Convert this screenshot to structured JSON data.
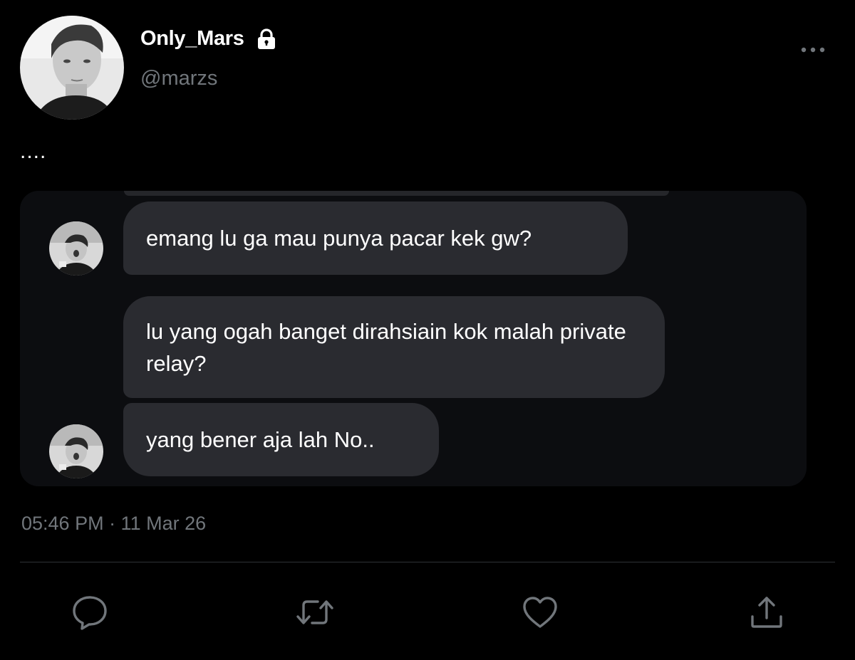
{
  "tweet": {
    "display_name": "Only_Mars",
    "handle": "@marzs",
    "text": "....",
    "timestamp": "05:46 PM · 11 Mar 26"
  },
  "icons": {
    "lock": "lock-icon",
    "more": "more-horizontal-icon",
    "reply": "speech-bubble-icon",
    "retweet": "retweet-icon",
    "like": "heart-icon",
    "share": "share-upload-icon"
  },
  "chat_screenshot": {
    "messages": [
      {
        "text": "emang lu ga mau punya pacar kek gw?"
      },
      {
        "text": "lu yang ogah banget dirahsiain kok malah private relay?"
      },
      {
        "text": "yang bener aja lah No.."
      }
    ]
  },
  "colors": {
    "background": "#000000",
    "primary_text": "#ffffff",
    "secondary_text": "#71767b",
    "bubble": "#2a2b30",
    "media_background": "#0c0d10",
    "divider": "#2f3336"
  }
}
